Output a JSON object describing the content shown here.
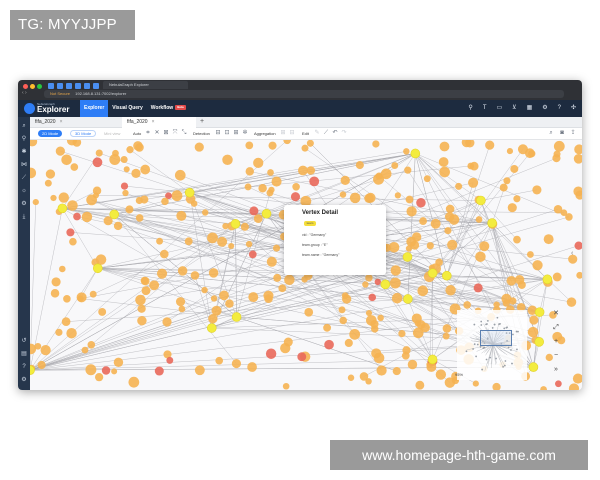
{
  "overlay": {
    "tag": "TG: MYYJJPP",
    "website": "www.homepage-hth-game.com"
  },
  "browser": {
    "tab_title": "NebulaGraph Explorer",
    "url": "192.168.8.131:7002/explorer",
    "security_label": "Not Secure",
    "nav_arrows": "‹ ›"
  },
  "app": {
    "logo_small": "NebulaGraph",
    "logo": "Explorer",
    "nav": [
      {
        "label": "Explorer"
      },
      {
        "label": "Visual Query"
      },
      {
        "label": "Workflow"
      }
    ],
    "workflow_badge": "Beta",
    "header_icons": [
      "filter-icon",
      "text-icon",
      "layout-icon",
      "pin-icon",
      "grid-icon",
      "settings-icon",
      "help-icon",
      "plugin-icon"
    ]
  },
  "tabs": [
    {
      "label": "fifa_2020",
      "close": "×"
    },
    {
      "label": "fifa_2020",
      "close": "×"
    }
  ],
  "add_tab": "+",
  "toolbar": {
    "mode_2d": "2D Mode",
    "mode_3d": "3D Mode",
    "mode_dim": "Mini view",
    "auto_label": "Auto",
    "detection_label": "Detection",
    "aggregation_label": "Aggregation",
    "edit_label": "Edit"
  },
  "vertex_detail": {
    "title": "Vertex Detail",
    "tag": "team",
    "fields": [
      {
        "key": "vid",
        "value": "\"Germany\""
      },
      {
        "key": "team.group",
        "value": "\"E\""
      },
      {
        "key": "team.name",
        "value": "\"Germany\""
      }
    ]
  },
  "minimap": {
    "zoom": "95%"
  },
  "colors": {
    "node_orange": "#f5b352",
    "node_yellow": "#f3ec3e",
    "node_red": "#e9685a",
    "header_bg": "#1d2b3f",
    "accent": "#2e7df6"
  }
}
